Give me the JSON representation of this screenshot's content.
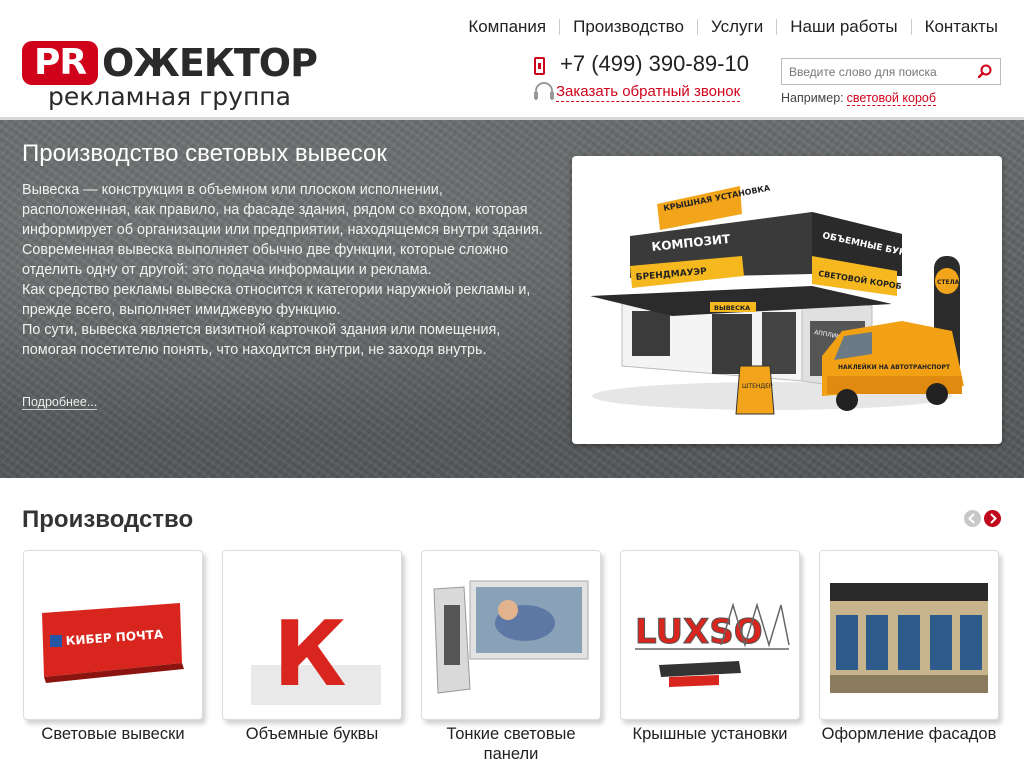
{
  "logo": {
    "pr": "PR",
    "rest": "ОЖЕКТОР",
    "subtitle": "рекламная группа"
  },
  "nav": {
    "items": [
      {
        "label": "Компания"
      },
      {
        "label": "Производство"
      },
      {
        "label": "Услуги"
      },
      {
        "label": "Наши работы"
      },
      {
        "label": "Контакты"
      }
    ]
  },
  "contacts": {
    "phone": "+7 (499) 390-89-10",
    "callback": "Заказать обратный звонок"
  },
  "search": {
    "placeholder": "Введите слово для поиска",
    "hint_label": "Например:",
    "hint_link": "световой короб"
  },
  "hero": {
    "title": "Производство световых вывесок",
    "paragraphs": [
      "Вывеска — конструкция в объемном или плоском исполнении, расположенная, как правило, на фасаде здания, рядом со входом, которая информирует об организации или предприятии, находящемся внутри здания. Современная вывеска выполняет обычно две функции, которые сложно отделить одну от другой: это подача информации и реклама.",
      "Как средство рекламы вывеска относится к категории наружной рекламы и, прежде всего, выполняет имиджевую функцию.",
      "По сути, вывеска является визитной карточкой здания или помещения, помогая посетителю понять, что находится внутри, не заходя внутрь."
    ],
    "more_link": "Подробнее...",
    "image_labels": {
      "roof": "КРЫШНАЯ УСТАНОВКА",
      "composite": "КОМПОЗИТ",
      "letters": "ОБЪЕМНЫЕ БУКВЫ",
      "firewall": "БРЕНДМАУЭР",
      "lightbox": "СВЕТОВОЙ КОРОБ",
      "sign": "ВЫВЕСКА",
      "stela": "СТЕЛА",
      "glass": "АППЛИКАЦИИ НА СТЕКЛО",
      "stickers": "НАКЛЕЙКИ НА АВТОТРАНСПОРТ",
      "shtender": "ШТЕНДЕР"
    }
  },
  "production": {
    "title": "Производство",
    "cards": [
      {
        "label": "Световые вывески",
        "image_text": "КИБЕР ПОЧТА"
      },
      {
        "label": "Объемные буквы",
        "image_text": "К"
      },
      {
        "label": "Тонкие световые панели"
      },
      {
        "label": "Крышные установки",
        "image_text": "LUXSO"
      },
      {
        "label": "Оформление фасадов"
      }
    ]
  },
  "colors": {
    "brand_red": "#d0021b",
    "hero_bg": "#5f6263",
    "text_dark": "#222222"
  }
}
